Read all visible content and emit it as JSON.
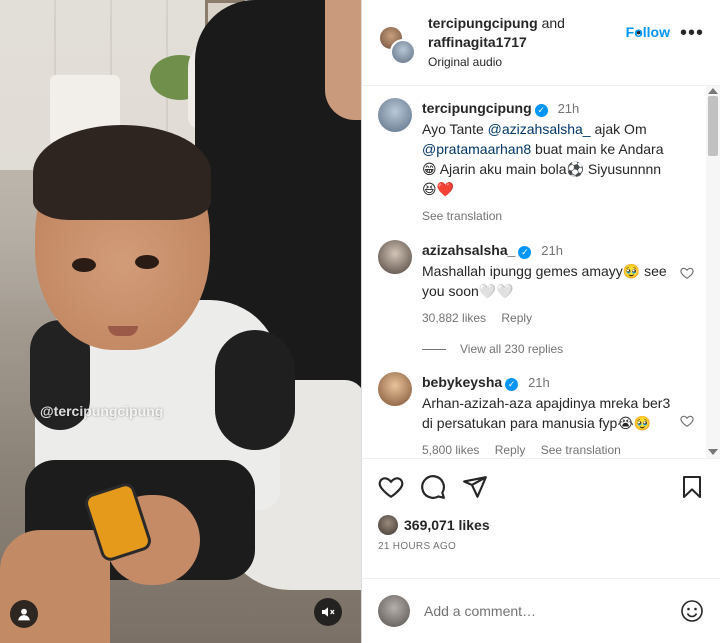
{
  "media": {
    "watermark": "@tercipungcipung"
  },
  "header": {
    "user1": "tercipungcipung",
    "and": "and",
    "user2": "raffinagita1717",
    "audio": "Original audio",
    "dot": "•",
    "follow": "Follow",
    "more": "•••"
  },
  "caption": {
    "username": "tercipungcipung",
    "time": "21h",
    "text_1": "Ayo Tante ",
    "mention_1": "@azizahsalsha_",
    "text_2": " ajak Om ",
    "mention_2": "@pratamaarhan8",
    "text_3": " buat main ke Andara 😁 Ajarin aku main bola⚽ Siyusunnnn 😆❤️",
    "see_translation": "See translation"
  },
  "comments": [
    {
      "username": "azizahsalsha_",
      "time": "21h",
      "text": "Mashallah ipungg gemes amayy🥹 see you soon🤍🤍",
      "likes": "30,882 likes",
      "reply": "Reply"
    },
    {
      "username": "bebykeysha",
      "time": "21h",
      "text": "Arhan-azizah-aza apajdinya mreka ber3 di persatukan para manusia fyp😭🥹",
      "likes": "5,800 likes",
      "reply": "Reply",
      "see_translation": "See translation"
    }
  ],
  "view_replies": "View all 230 replies",
  "actions": {
    "likes_count": "369,071 likes",
    "posted": "21 HOURS AGO"
  },
  "add_comment": {
    "placeholder": "Add a comment…"
  },
  "colors": {
    "accent": "#0095f6",
    "text": "#262626",
    "muted": "#737373",
    "heart": "#ed4956"
  }
}
